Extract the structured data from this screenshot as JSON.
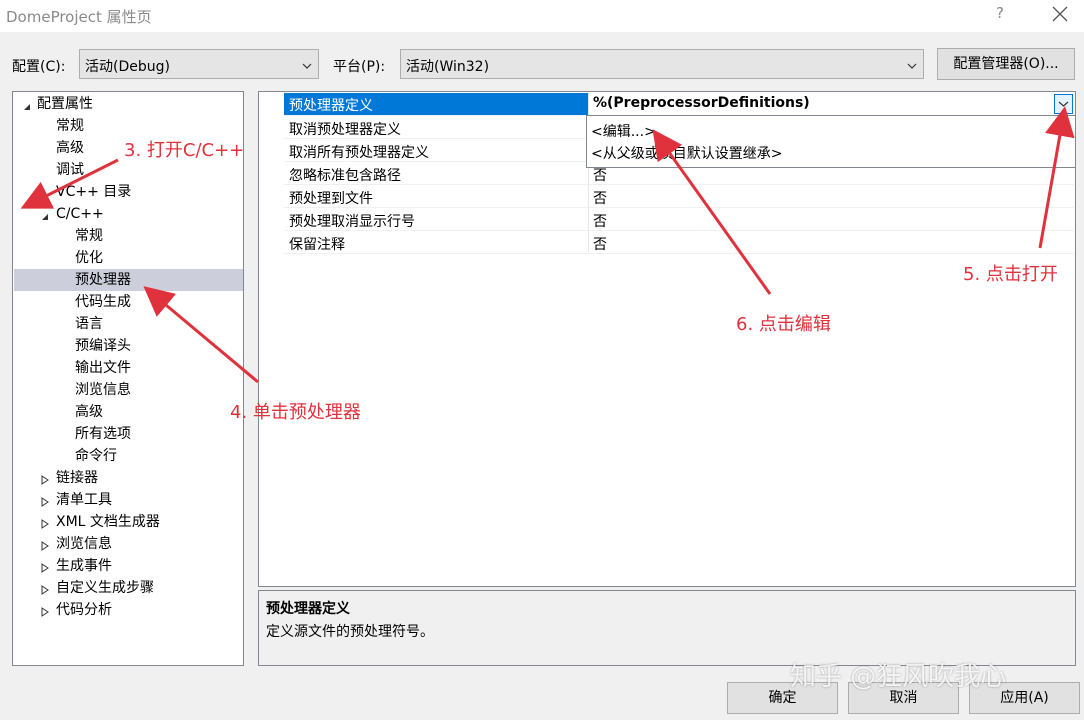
{
  "window": {
    "title": "DomeProject 属性页",
    "help_glyph": "?"
  },
  "toolbar": {
    "config_label": "配置(C):",
    "config_value": "活动(Debug)",
    "platform_label": "平台(P):",
    "platform_value": "活动(Win32)",
    "config_manager_label": "配置管理器(O)..."
  },
  "tree": {
    "root": "配置属性",
    "general": "常规",
    "advanced": "高级",
    "debugging": "调试",
    "vc_dirs": "VC++ 目录",
    "cpp": {
      "label": "C/C++",
      "children": [
        "常规",
        "优化",
        "预处理器",
        "代码生成",
        "语言",
        "预编译头",
        "输出文件",
        "浏览信息",
        "高级",
        "所有选项",
        "命令行"
      ],
      "selected": "预处理器"
    },
    "collapsed": [
      "链接器",
      "清单工具",
      "XML 文档生成器",
      "浏览信息",
      "生成事件",
      "自定义生成步骤",
      "代码分析"
    ]
  },
  "grid": {
    "rows": [
      {
        "name": "预处理器定义",
        "value": "%(PreprocessorDefinitions)"
      },
      {
        "name": "取消预处理器定义",
        "value": ""
      },
      {
        "name": "取消所有预处理器定义",
        "value": ""
      },
      {
        "name": "忽略标准包含路径",
        "value": "否"
      },
      {
        "name": "预处理到文件",
        "value": "否"
      },
      {
        "name": "预处理取消显示行号",
        "value": "否"
      },
      {
        "name": "保留注释",
        "value": "否"
      }
    ],
    "dropdown_options": [
      "<编辑...>",
      "<从父级或项目默认设置继承>"
    ]
  },
  "description": {
    "heading": "预处理器定义",
    "text": "定义源文件的预处理符号。"
  },
  "buttons": {
    "ok": "确定",
    "cancel": "取消",
    "apply": "应用(A)"
  },
  "annotations": {
    "step3": "3. 打开C/C++",
    "step4": "4. 单击预处理器",
    "step5": "5. 点击打开",
    "step6": "6. 点击编辑"
  },
  "watermark": "知乎 @狂风吹我心",
  "colors": {
    "selection": "#0078d7",
    "tree_selection": "#cccedb",
    "annotation": "#e0323c"
  }
}
